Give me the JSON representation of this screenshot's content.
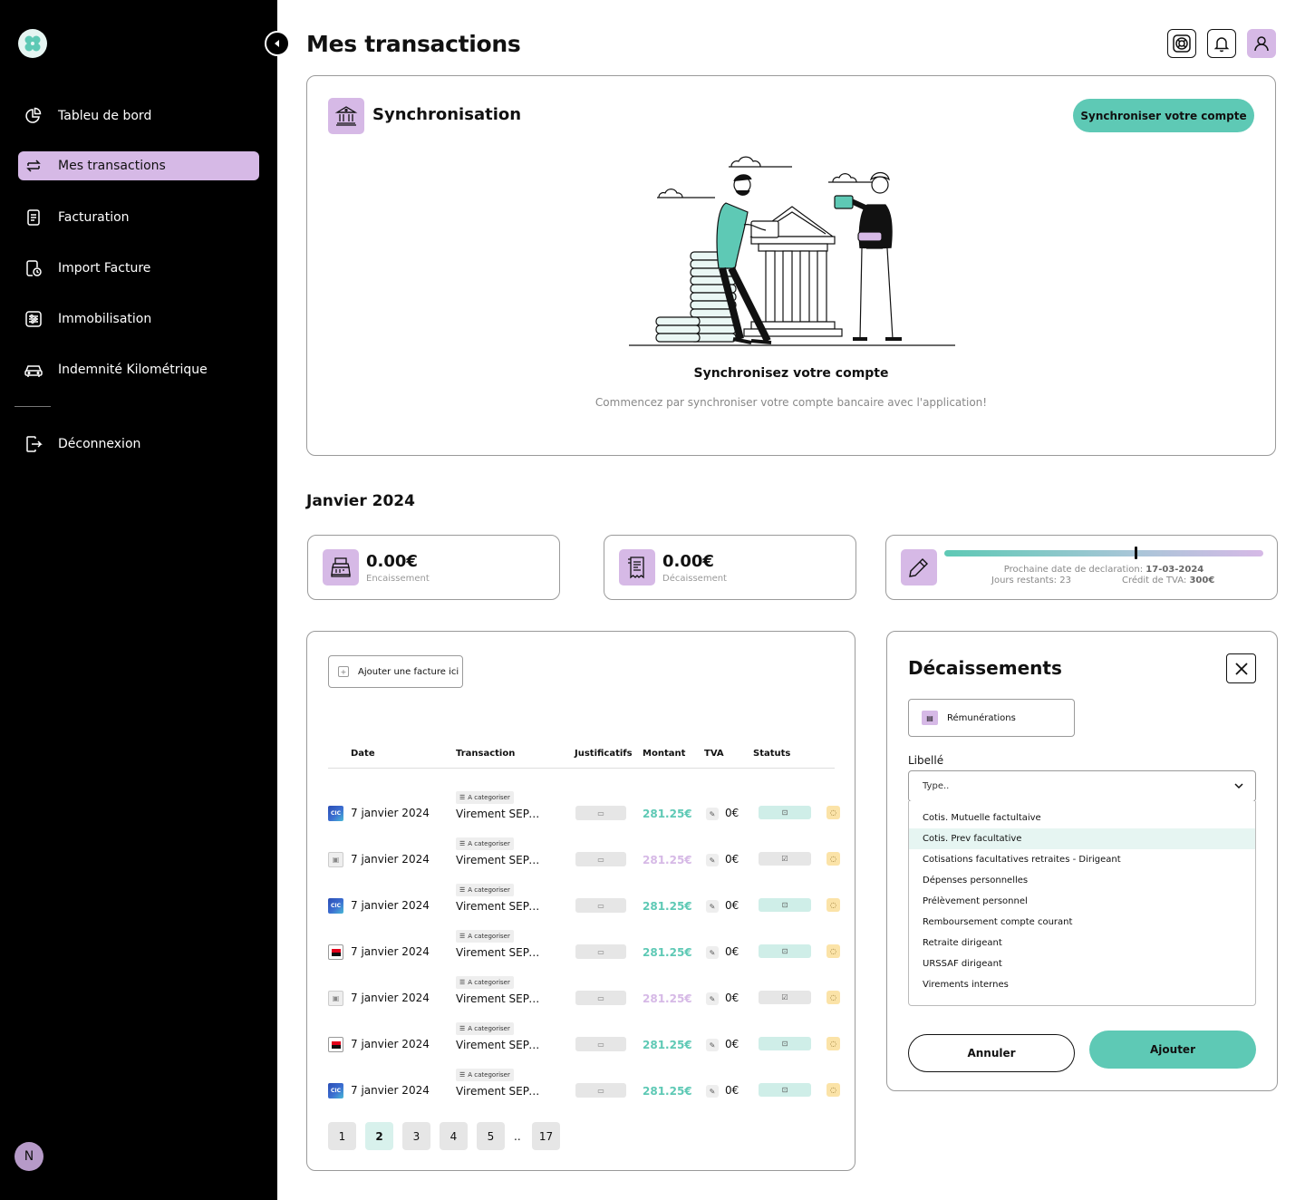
{
  "sidebar": {
    "items": [
      {
        "label": "Tableu de bord",
        "icon": "pie-chart-icon"
      },
      {
        "label": "Mes transactions",
        "icon": "transfer-arrows-icon"
      },
      {
        "label": "Facturation",
        "icon": "document-icon"
      },
      {
        "label": "Import Facture",
        "icon": "document-clock-icon"
      },
      {
        "label": "Immobilisation",
        "icon": "sliders-icon"
      },
      {
        "label": "Indemnité Kilométrique",
        "icon": "car-icon"
      }
    ],
    "logout_label": "Déconnexion",
    "avatar_initial": "N",
    "active_index": 1
  },
  "header": {
    "title": "Mes transactions",
    "buttons": [
      "support-icon",
      "bell-icon",
      "user-icon"
    ]
  },
  "sync": {
    "title": "Synchronisation",
    "button_label": "Synchroniser votre compte",
    "heading": "Synchronisez votre compte",
    "subtitle": "Commencez par synchroniser votre compte bancaire avec l'application!"
  },
  "month": {
    "title": "Janvier 2024"
  },
  "stats": {
    "encaissement": {
      "value": "0.00€",
      "label": "Encaissement"
    },
    "decaissement": {
      "value": "0.00€",
      "label": "Décaissement"
    },
    "declaration": {
      "next_label": "Prochaine date de declaration:",
      "next_date": "17-03-2024",
      "days_label": "Jours restants:",
      "days_value": "23",
      "credit_label": "Crédit de TVA:",
      "credit_value": "300€",
      "progress": 0.6
    }
  },
  "table": {
    "add_invoice_label": "Ajouter une facture ici",
    "headers": {
      "date": "Date",
      "transaction": "Transaction",
      "justificatifs": "Justificatifs",
      "montant": "Montant",
      "tva": "TVA",
      "statuts": "Statuts"
    },
    "rows": [
      {
        "bank": "cic",
        "date": "7 janvier 2024",
        "tag": "A categoriser",
        "transaction": "Virement SEPA Chèque",
        "amount": "281.25€",
        "amount_color": "teal",
        "tva": "0€",
        "status": "teal"
      },
      {
        "bank": "doc",
        "date": "7 janvier 2024",
        "tag": "A categoriser",
        "transaction": "Virement SEPA Chèque",
        "amount": "281.25€",
        "amount_color": "lilac",
        "tva": "0€",
        "status": "grey"
      },
      {
        "bank": "cic",
        "date": "7 janvier 2024",
        "tag": "A categoriser",
        "transaction": "Virement SEPA Chèque",
        "amount": "281.25€",
        "amount_color": "teal",
        "tva": "0€",
        "status": "teal"
      },
      {
        "bank": "sg",
        "date": "7 janvier 2024",
        "tag": "A categoriser",
        "transaction": "Virement SEPA Chèque",
        "amount": "281.25€",
        "amount_color": "teal",
        "tva": "0€",
        "status": "teal"
      },
      {
        "bank": "doc",
        "date": "7 janvier 2024",
        "tag": "A categoriser",
        "transaction": "Virement SEPA Chèque",
        "amount": "281.25€",
        "amount_color": "lilac",
        "tva": "0€",
        "status": "grey"
      },
      {
        "bank": "sg",
        "date": "7 janvier 2024",
        "tag": "A categoriser",
        "transaction": "Virement SEPA Chèque",
        "amount": "281.25€",
        "amount_color": "teal",
        "tva": "0€",
        "status": "teal"
      },
      {
        "bank": "cic",
        "date": "7 janvier 2024",
        "tag": "A categoriser",
        "transaction": "Virement SEPA Chèque",
        "amount": "281.25€",
        "amount_color": "teal",
        "tva": "0€",
        "status": "teal"
      }
    ],
    "pagination": {
      "pages": [
        "1",
        "2",
        "3",
        "4",
        "5"
      ],
      "ellipsis": "..",
      "last": "17",
      "active": "2"
    }
  },
  "panel": {
    "title": "Décaissements",
    "category_label": "Rémunérations",
    "field_label": "Libellé",
    "select_placeholder": "Type..",
    "options": [
      "Cotis. Mutuelle factultaive",
      "Cotis. Prev facultative",
      "Cotisations facultatives retraites - Dirigeant",
      "Dépenses personnelles",
      "Prélèvement personnel",
      "Remboursement compte courant",
      "Retraite dirigeant",
      "URSSAF dirigeant",
      "Virements internes"
    ],
    "highlighted_index": 1,
    "cancel_label": "Annuler",
    "add_label": "Ajouter"
  },
  "colors": {
    "teal": "#5ec9b5",
    "lilac": "#d6b9e6",
    "sidebar": "#000000"
  }
}
